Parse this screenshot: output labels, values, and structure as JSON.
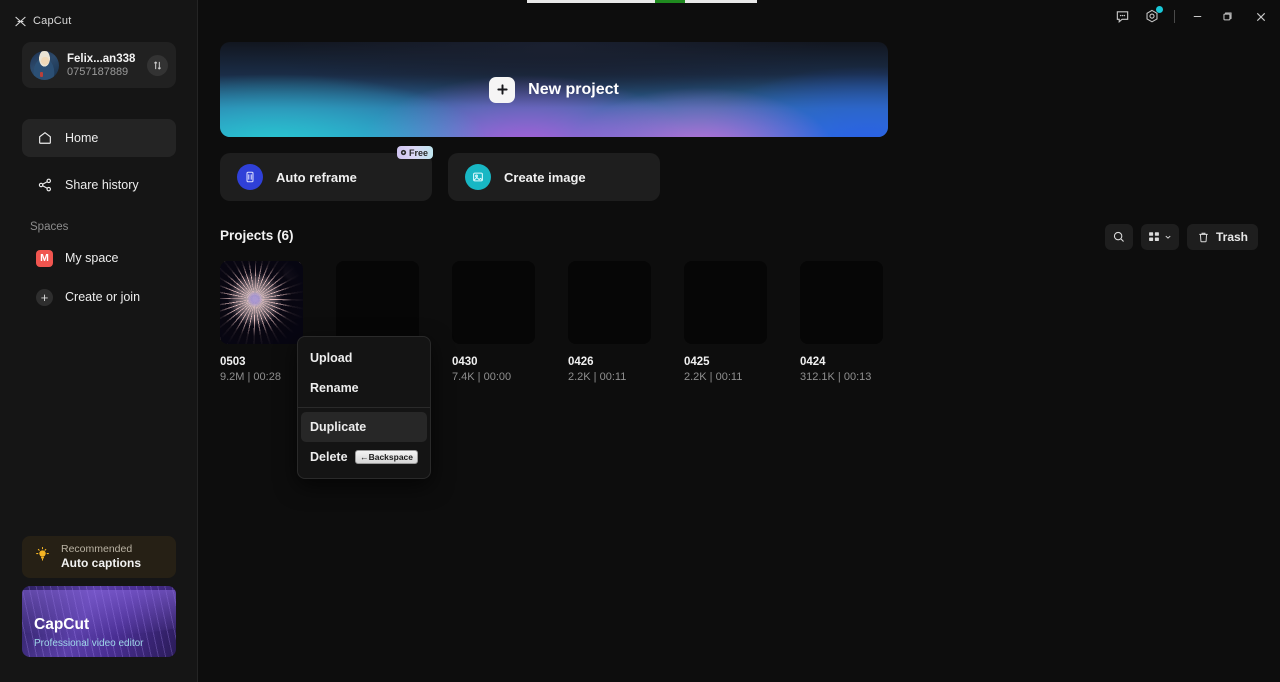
{
  "app": {
    "brand": "CapCut"
  },
  "titlebar": {
    "feedback_icon": "feedback-icon",
    "settings_icon": "gear-icon",
    "minimize_icon": "minimize-icon",
    "maximize_icon": "maximize-icon",
    "close_icon": "close-icon",
    "notification_dot_color": "#18c8d8"
  },
  "top_strip": {
    "track_color": "#e8e8e8",
    "segment_color": "#1f8a1f"
  },
  "account": {
    "name": "Felix...an338",
    "id": "0757187889",
    "avatar": "user-avatar",
    "switch_icon": "switch-account-icon"
  },
  "sidebar": {
    "items": [
      {
        "label": "Home",
        "icon": "home-icon",
        "active": true
      },
      {
        "label": "Share history",
        "icon": "share-icon",
        "active": false
      }
    ],
    "spaces_heading": "Spaces",
    "spaces": [
      {
        "label": "My space",
        "badge": "M",
        "badge_color": "#f0554f"
      },
      {
        "label": "Create or join",
        "icon": "plus-icon"
      }
    ],
    "recommended": {
      "icon": "lightbulb-icon",
      "kicker": "Recommended",
      "title": "Auto captions"
    },
    "promo": {
      "title": "CapCut",
      "subtitle": "Professional video editor"
    }
  },
  "main": {
    "new_project": {
      "label": "New project",
      "icon": "plus-icon"
    },
    "features": [
      {
        "label": "Auto reframe",
        "icon": "auto-reframe-icon",
        "icon_color": "#2f40d8",
        "badge": "Free",
        "badge_icon": "crown-icon"
      },
      {
        "label": "Create image",
        "icon": "image-icon",
        "icon_color": "#18b7c4",
        "badge": null
      }
    ],
    "projects_heading": "Projects",
    "projects_count": "(6)",
    "toolbar": {
      "search_icon": "search-icon",
      "view_icon": "grid-view-icon",
      "view_chevron": "chevron-down-icon",
      "trash_icon": "trash-icon",
      "trash_label": "Trash"
    },
    "projects": [
      {
        "name": "0503",
        "meta": "9.2M | 00:28",
        "thumb": "fireworks"
      },
      {
        "name": "",
        "meta": "",
        "thumb": "blank"
      },
      {
        "name": "0430",
        "meta": "7.4K | 00:00",
        "thumb": "blank"
      },
      {
        "name": "0426",
        "meta": "2.2K | 00:11",
        "thumb": "blank"
      },
      {
        "name": "0425",
        "meta": "2.2K | 00:11",
        "thumb": "blank"
      },
      {
        "name": "0424",
        "meta": "312.1K | 00:13",
        "thumb": "blank"
      }
    ]
  },
  "context_menu": {
    "items": [
      {
        "label": "Upload",
        "shortcut": "",
        "highlighted": false
      },
      {
        "label": "Rename",
        "shortcut": "",
        "highlighted": false
      },
      {
        "label": "Duplicate",
        "shortcut": "",
        "highlighted": true
      },
      {
        "label": "Delete",
        "shortcut": "←Backspace",
        "highlighted": false
      }
    ]
  }
}
